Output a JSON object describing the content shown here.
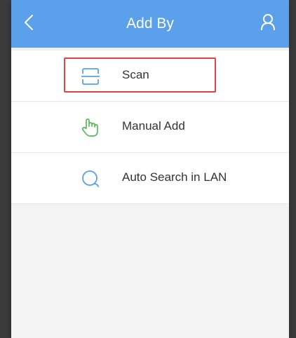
{
  "header": {
    "title": "Add By",
    "background": "#5aa0ea",
    "back_icon": "chevron-left-icon",
    "user_icon": "user-icon"
  },
  "options": [
    {
      "label": "Scan",
      "icon": "scan-icon",
      "highlighted": true
    },
    {
      "label": "Manual Add",
      "icon": "hand-pointer-icon",
      "highlighted": false
    },
    {
      "label": "Auto Search in LAN",
      "icon": "search-icon",
      "highlighted": false
    }
  ],
  "colors": {
    "highlight_border": "#e0453e",
    "scan_icon": "#5aa0ea",
    "hand_icon": "#5cb85c",
    "search_icon": "#5aa0ea"
  }
}
